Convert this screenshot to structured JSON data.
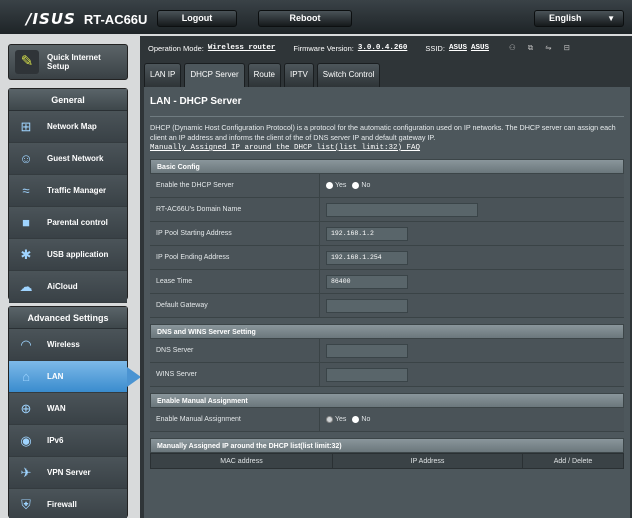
{
  "header": {
    "logo": "/ISUS",
    "model": "RT-AC66U",
    "logout_label": "Logout",
    "reboot_label": "Reboot",
    "language": "English"
  },
  "info": {
    "op_mode_label": "Operation Mode:",
    "op_mode_value": "Wireless router",
    "firmware_label": "Firmware Version:",
    "firmware_value": "3.0.0.4.260",
    "ssid_label": "SSID:",
    "ssid_values": [
      "ASUS",
      "ASUS"
    ]
  },
  "sidebar": {
    "quick_setup": "Quick Internet Setup",
    "general_title": "General",
    "general_items": [
      {
        "label": "Network Map",
        "icon": "network-map-icon"
      },
      {
        "label": "Guest Network",
        "icon": "guest-network-icon"
      },
      {
        "label": "Traffic Manager",
        "icon": "traffic-manager-icon"
      },
      {
        "label": "Parental control",
        "icon": "parental-control-icon"
      },
      {
        "label": "USB application",
        "icon": "usb-application-icon"
      },
      {
        "label": "AiCloud",
        "icon": "aicloud-icon"
      }
    ],
    "advanced_title": "Advanced Settings",
    "advanced_items": [
      {
        "label": "Wireless",
        "icon": "wireless-icon"
      },
      {
        "label": "LAN",
        "icon": "lan-icon",
        "active": true
      },
      {
        "label": "WAN",
        "icon": "wan-icon"
      },
      {
        "label": "IPv6",
        "icon": "ipv6-icon"
      },
      {
        "label": "VPN Server",
        "icon": "vpn-server-icon"
      },
      {
        "label": "Firewall",
        "icon": "firewall-icon"
      }
    ]
  },
  "tabs": [
    "LAN IP",
    "DHCP Server",
    "Route",
    "IPTV",
    "Switch Control"
  ],
  "active_tab": "DHCP Server",
  "panel": {
    "title": "LAN - DHCP Server",
    "description": "DHCP (Dynamic Host Configuration Protocol) is a protocol for the automatic configuration used on IP networks. The DHCP server can assign each client an IP address and informs the client of the of DNS server IP and default gateway IP.",
    "faq_link": "Manually Assigned IP around the DHCP list(list limit:32) FAQ"
  },
  "basic_config": {
    "title": "Basic Config",
    "enable_label": "Enable the DHCP Server",
    "yes": "Yes",
    "no": "No",
    "domain_label": "RT-AC66U's Domain Name",
    "domain_value": "",
    "start_label": "IP Pool Starting Address",
    "start_value": "192.168.1.2",
    "end_label": "IP Pool Ending Address",
    "end_value": "192.168.1.254",
    "lease_label": "Lease Time",
    "lease_value": "86400",
    "gateway_label": "Default Gateway",
    "gateway_value": ""
  },
  "dns": {
    "title": "DNS and WINS Server Setting",
    "dns_label": "DNS Server",
    "dns_value": "",
    "wins_label": "WINS Server",
    "wins_value": ""
  },
  "manual": {
    "title": "Enable Manual Assignment",
    "label": "Enable Manual Assignment",
    "yes": "Yes",
    "no": "No"
  },
  "ip_list": {
    "title": "Manually Assigned IP around the DHCP list(list limit:32)",
    "col_mac": "MAC address",
    "col_ip": "IP Address",
    "col_action": "Add / Delete"
  }
}
